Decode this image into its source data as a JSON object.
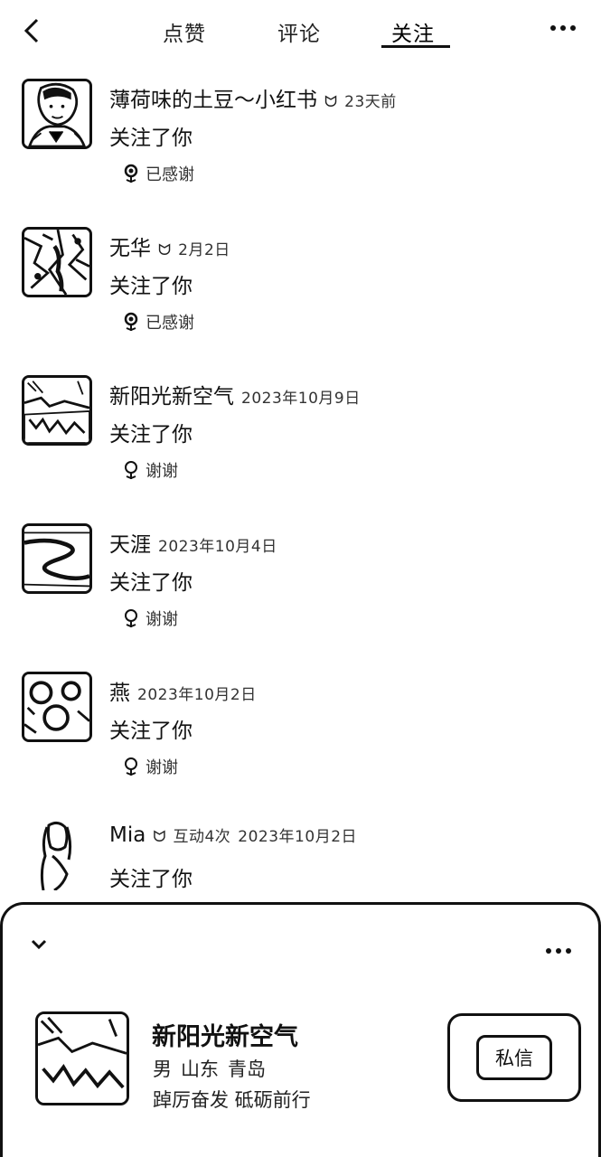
{
  "header": {
    "tabs": [
      {
        "label": "点赞"
      },
      {
        "label": "评论"
      },
      {
        "label": "关注"
      }
    ],
    "active_tab": "关注"
  },
  "notifications": [
    {
      "name": "薄荷味的土豆～小红书",
      "badge_icon": "mutual-icon",
      "time": "23天前",
      "action": "关注了你",
      "thanks_label": "已感谢",
      "thanked": true
    },
    {
      "name": "无华",
      "badge_icon": "mutual-icon",
      "time": "2月2日",
      "action": "关注了你",
      "thanks_label": "已感谢",
      "thanked": true
    },
    {
      "name": "新阳光新空气",
      "time": "2023年10月9日",
      "action": "关注了你",
      "thanks_label": "谢谢",
      "thanked": false
    },
    {
      "name": "天涯",
      "time": "2023年10月4日",
      "action": "关注了你",
      "thanks_label": "谢谢",
      "thanked": false
    },
    {
      "name": "燕",
      "time": "2023年10月2日",
      "action": "关注了你",
      "thanks_label": "谢谢",
      "thanked": false
    },
    {
      "name": "Mia",
      "badge_icon": "mutual-icon",
      "interaction": "互动4次",
      "time": "2023年10月2日",
      "action": "关注了你"
    }
  ],
  "profile_sheet": {
    "name": "新阳光新空气",
    "gender": "男",
    "province": "山东",
    "city": "青岛",
    "bio": "踔厉奋发 砥砺前行",
    "message_button": "私信"
  }
}
